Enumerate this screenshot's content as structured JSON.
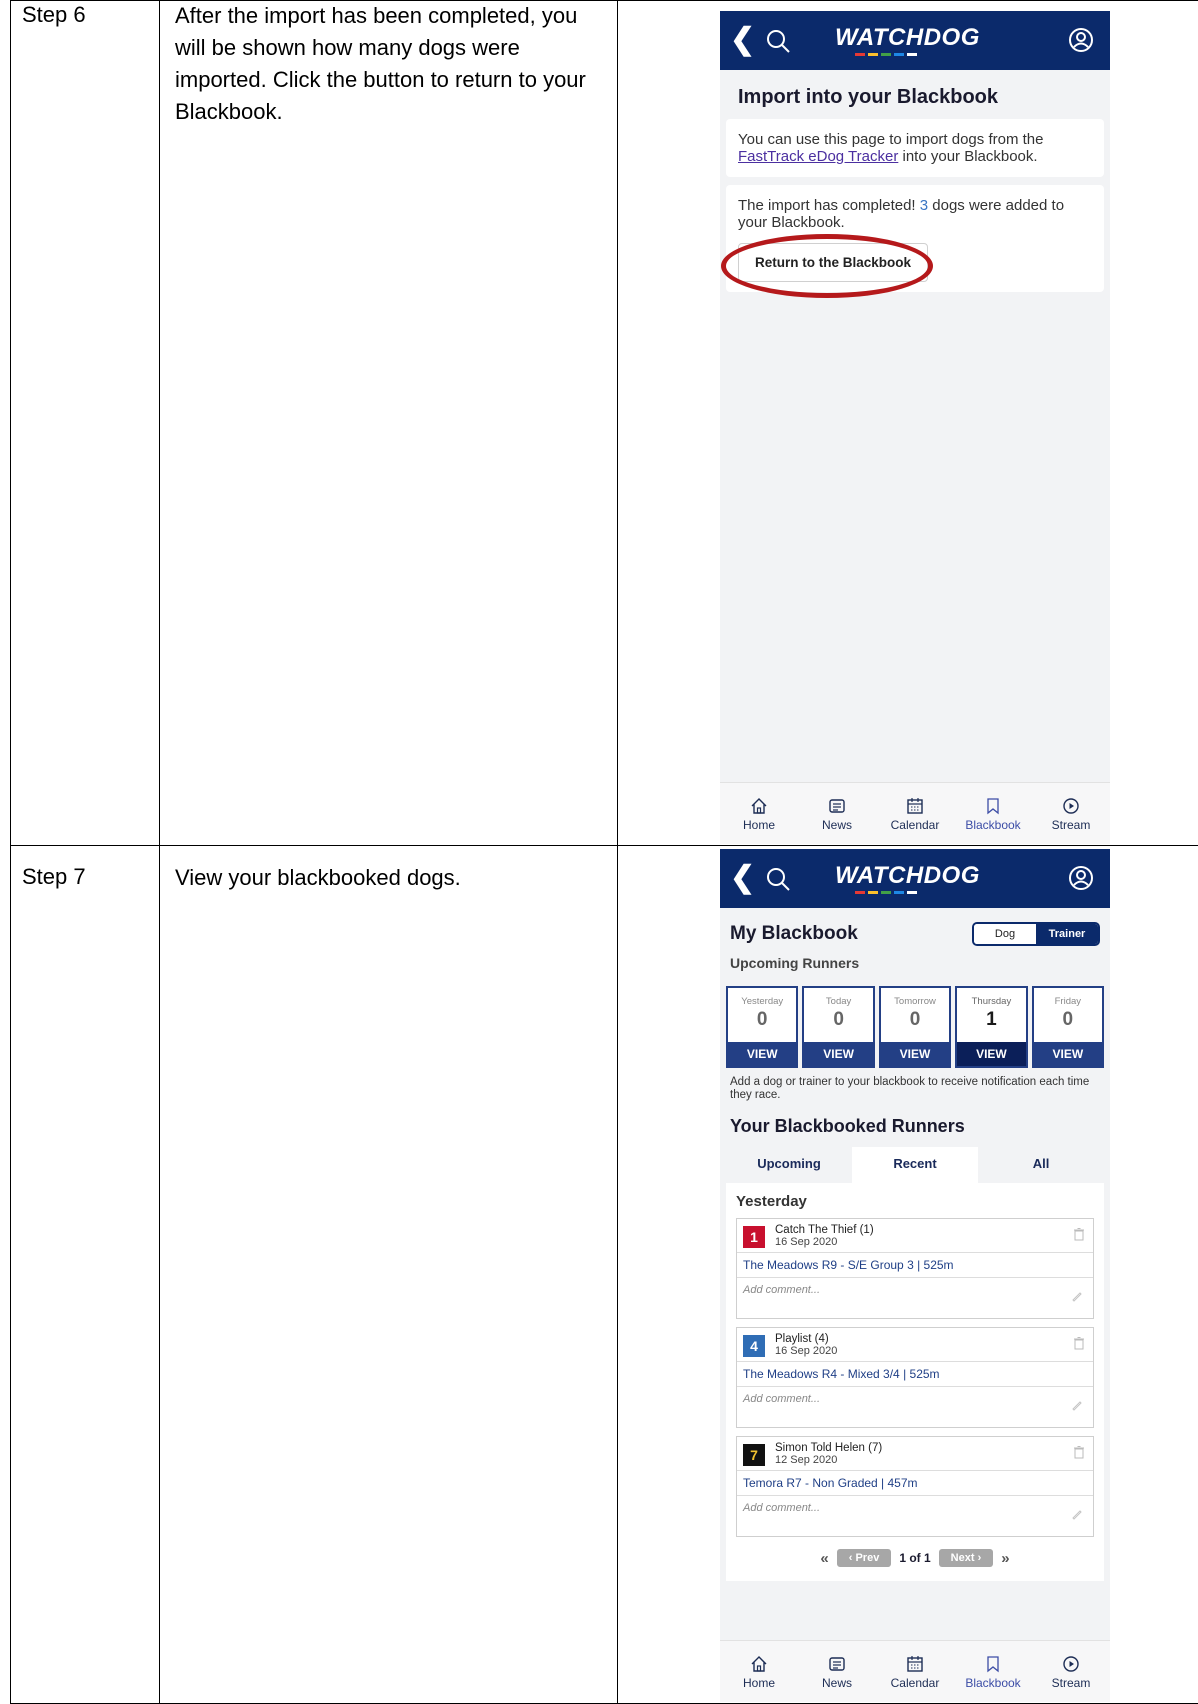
{
  "steps": [
    {
      "label": "Step 6",
      "description": "After the import has been completed, you will be shown how many dogs were imported. Click the button to return to your Blackbook."
    },
    {
      "label": "Step 7",
      "description": "View your blackbooked dogs."
    }
  ],
  "app": {
    "logo": "WATCHDOG",
    "nav": [
      "Home",
      "News",
      "Calendar",
      "Blackbook",
      "Stream"
    ]
  },
  "import_screen": {
    "title": "Import into your Blackbook",
    "intro_pre": "You can use this page to import dogs from the ",
    "intro_link": "FastTrack eDog Tracker",
    "intro_post": " into your Blackbook.",
    "result_pre": "The import has completed! ",
    "result_count": "3",
    "result_post": " dogs were added to your Blackbook.",
    "return_button": "Return to the Blackbook"
  },
  "blackbook_screen": {
    "title": "My Blackbook",
    "subtitle": "Upcoming Runners",
    "toggle": [
      "Dog",
      "Trainer"
    ],
    "days": [
      {
        "name": "Yesterday",
        "count": "0",
        "view": "VIEW"
      },
      {
        "name": "Today",
        "count": "0",
        "view": "VIEW"
      },
      {
        "name": "Tomorrow",
        "count": "0",
        "view": "VIEW"
      },
      {
        "name": "Thursday",
        "count": "1",
        "view": "VIEW"
      },
      {
        "name": "Friday",
        "count": "0",
        "view": "VIEW"
      }
    ],
    "info": "Add a dog or trainer to your blackbook to receive notification each time they race.",
    "runners_heading": "Your Blackbooked Runners",
    "tabs": [
      "Upcoming",
      "Recent",
      "All"
    ],
    "group_label": "Yesterday",
    "runners": [
      {
        "box": "1",
        "name": "Catch The Thief (1)",
        "date": "16 Sep 2020",
        "race": "The Meadows R9 - S/E Group 3  |  525m",
        "comment_placeholder": "Add comment..."
      },
      {
        "box": "4",
        "name": "Playlist (4)",
        "date": "16 Sep 2020",
        "race": "The Meadows R4 - Mixed 3/4  |  525m",
        "comment_placeholder": "Add comment..."
      },
      {
        "box": "7",
        "name": "Simon Told Helen (7)",
        "date": "12 Sep 2020",
        "race": "Temora R7 - Non Graded  |  457m",
        "comment_placeholder": "Add comment..."
      }
    ],
    "pager": {
      "prev": "‹ Prev",
      "page": "1 of 1",
      "next": "Next ›",
      "first": "«",
      "last": "»"
    }
  },
  "colors": {
    "header": "#0b2a6b",
    "box1": "#c8102e",
    "box4": "#2f6db5",
    "box7": "#111111",
    "highlight_ring": "#b5191b"
  }
}
